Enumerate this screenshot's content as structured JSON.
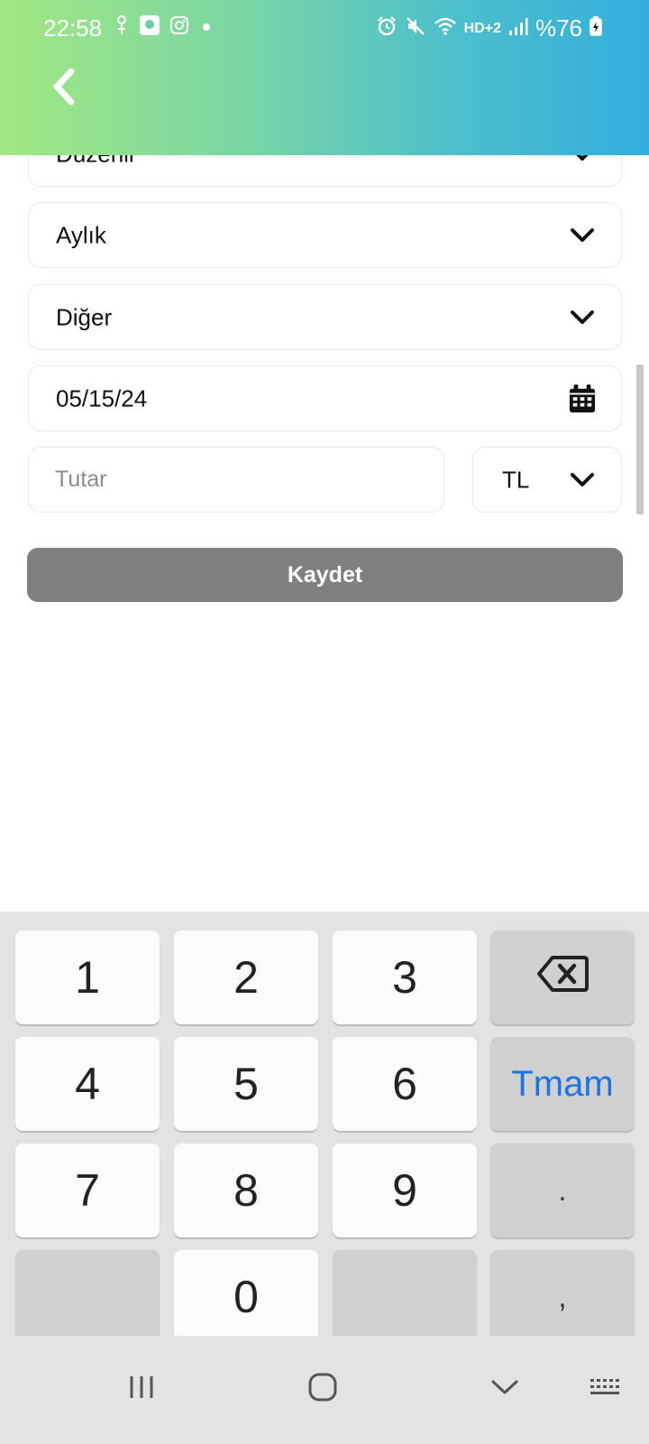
{
  "status_bar": {
    "time": "22:58",
    "hd_label": "HD+2",
    "battery_percent": "%76",
    "icons": [
      "network-icon",
      "app-icon",
      "instagram-icon",
      "dot-icon",
      "alarm-icon",
      "mute-icon",
      "wifi-icon",
      "signal-icon",
      "battery-icon"
    ]
  },
  "header": {
    "back_icon": "chevron-left-icon",
    "gradient_start": "#a2e882",
    "gradient_end": "#32aedd"
  },
  "form": {
    "field_partial": "Düzenli",
    "frequency": "Aylık",
    "category": "Diğer",
    "date": "05/15/24",
    "amount": {
      "value": "",
      "placeholder": "Tutar"
    },
    "currency": "TL",
    "save_label": "Kaydet"
  },
  "keyboard": {
    "keys": [
      "1",
      "2",
      "3",
      "4",
      "5",
      "6",
      "7",
      "8",
      "9",
      "0",
      ".",
      ","
    ],
    "done_label": "Tmam",
    "done_color": "#1a73e8",
    "backspace_icon": "backspace-icon"
  },
  "navbar": {
    "icons": [
      "recent-apps-icon",
      "home-icon",
      "back-down-icon",
      "keyboard-icon"
    ]
  }
}
